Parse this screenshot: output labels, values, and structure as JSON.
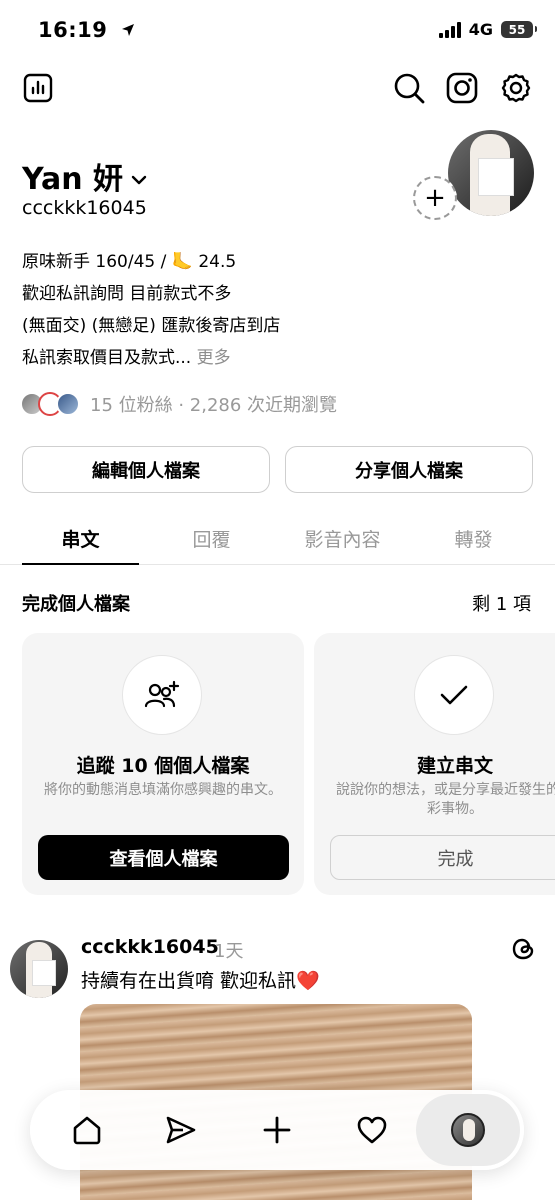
{
  "status": {
    "time": "16:19",
    "network": "4G",
    "battery": "55"
  },
  "profile": {
    "name": "Yan 妍",
    "handle": "ccckkk16045",
    "bio_lines": [
      "原味新手 160/45 / 🦶 24.5",
      "歡迎私訊詢問 目前款式不多",
      "(無面交) (無戀足) 匯款後寄店到店",
      "私訊索取價目及款式..."
    ],
    "bio_more": "更多",
    "followers_text": "15 位粉絲 · 2,286 次近期瀏覽"
  },
  "buttons": {
    "edit_profile": "編輯個人檔案",
    "share_profile": "分享個人檔案"
  },
  "tabs": [
    "串文",
    "回覆",
    "影音內容",
    "轉發"
  ],
  "complete_profile": {
    "title": "完成個人檔案",
    "remaining": "剩 1 項",
    "cards": [
      {
        "title": "追蹤 10 個個人檔案",
        "desc": "將你的動態消息填滿你感興趣的串文。",
        "button": "查看個人檔案",
        "icon": "add-people-icon"
      },
      {
        "title": "建立串文",
        "desc": "說說你的想法，或是分享最近發生的精彩事物。",
        "button": "完成",
        "icon": "check-icon"
      }
    ]
  },
  "post": {
    "user": "ccckkk16045",
    "time": "1天",
    "text": "持續有在出貨唷 歡迎私訊",
    "emoji": "❤️"
  },
  "nav": [
    "home-icon",
    "send-icon",
    "plus-icon",
    "heart-icon",
    "profile-avatar"
  ]
}
